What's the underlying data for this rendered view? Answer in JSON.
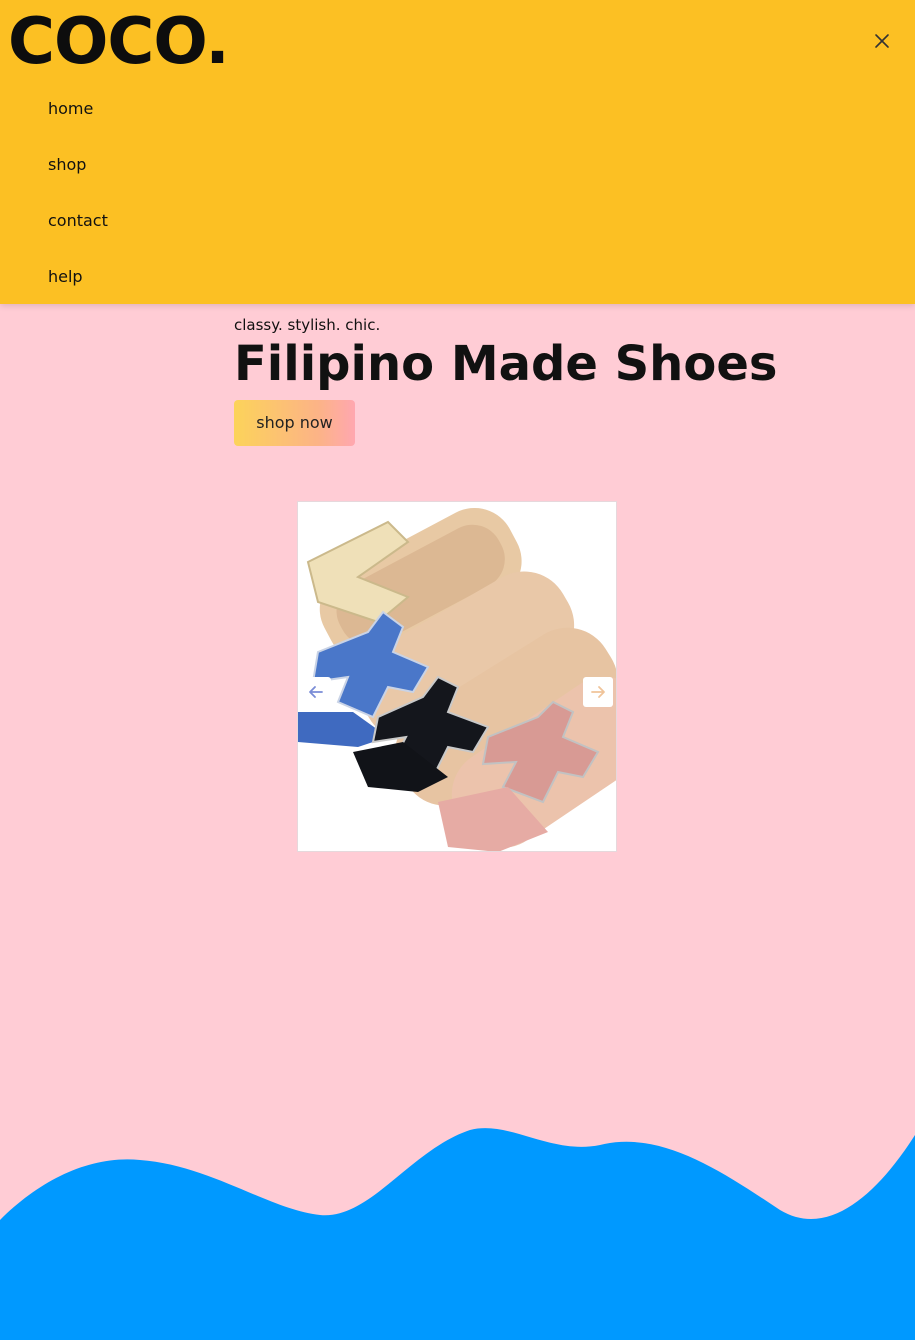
{
  "brand": {
    "logo": "COCO."
  },
  "nav": {
    "items": [
      "home",
      "shop",
      "contact",
      "help"
    ]
  },
  "hero": {
    "tagline": "classy. stylish. chic.",
    "headline": "Filipino Made Shoes",
    "cta": "shop now"
  },
  "carousel": {
    "image_alt": "sandals",
    "prev_icon": "arrow-left-icon",
    "next_icon": "arrow-right-icon"
  },
  "footer": {
    "text": ""
  },
  "colors": {
    "header_bg": "#fcc023",
    "page_bg": "#ffccd5",
    "wave": "#0099ff",
    "accent_arrow": "#7a8cd6"
  }
}
